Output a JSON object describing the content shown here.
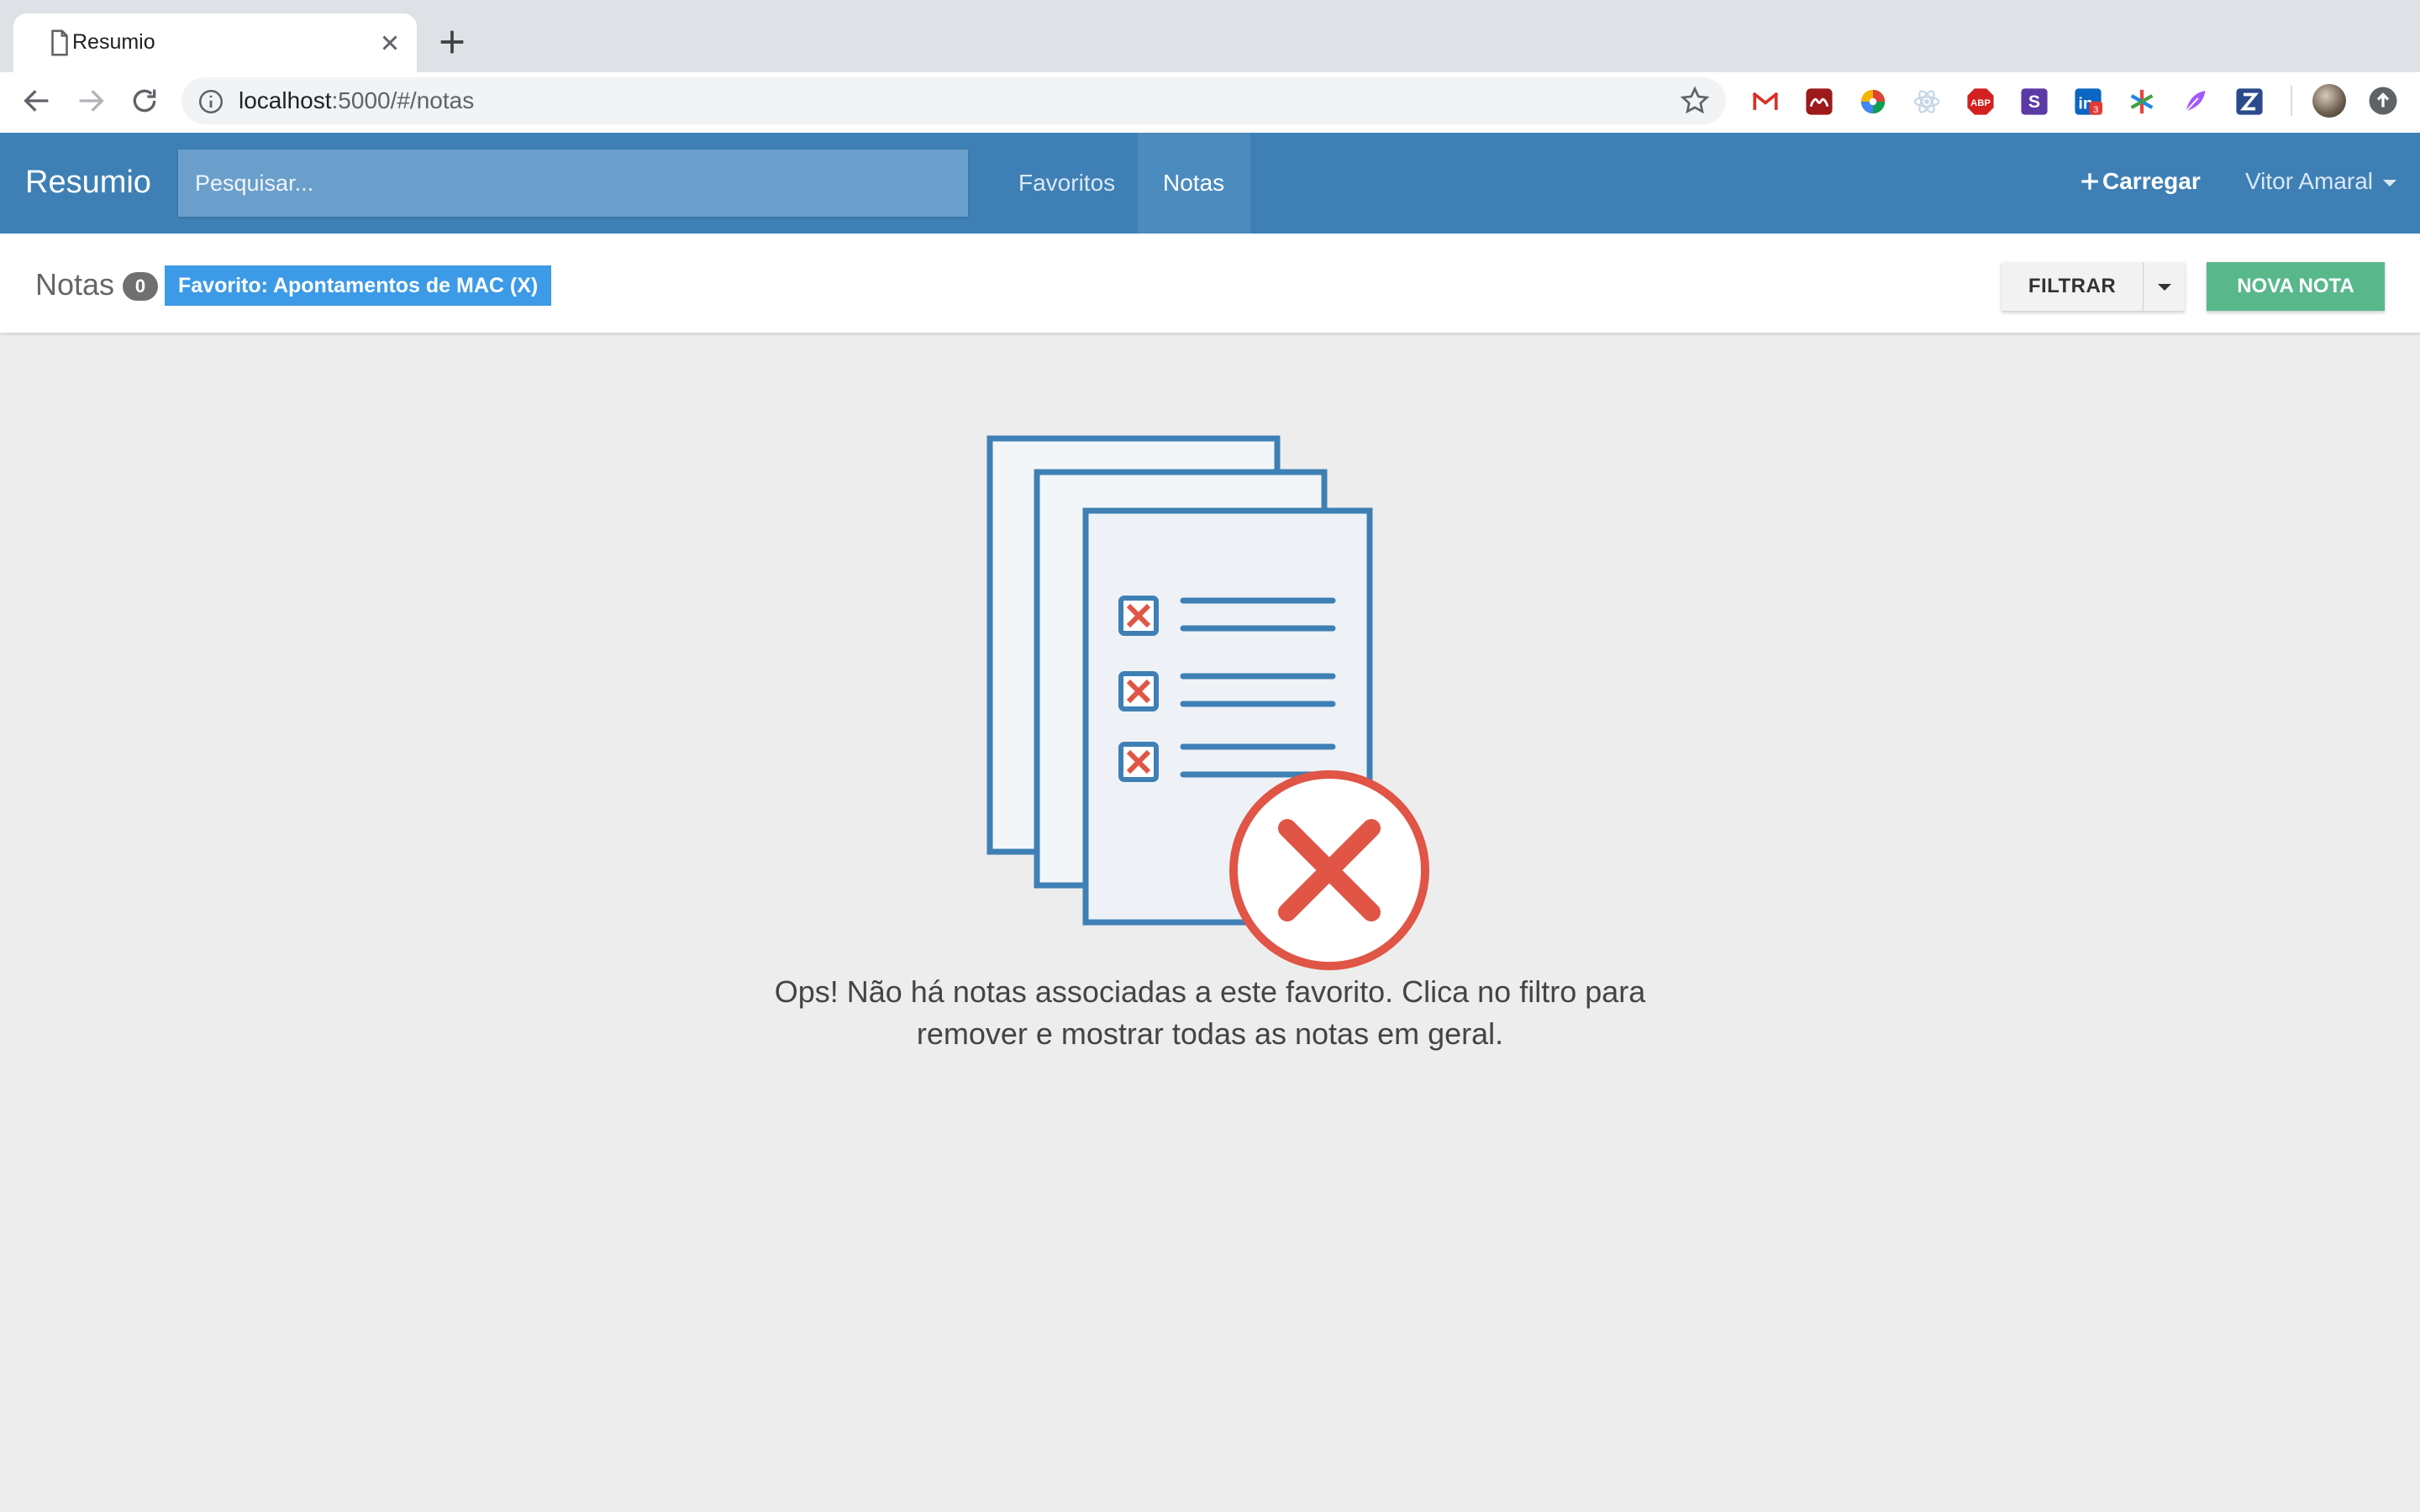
{
  "browser": {
    "tab_title": "Resumio",
    "url_host": "localhost",
    "url_path": ":5000/#/notas",
    "extensions": [
      {
        "name": "gmail-icon",
        "color": "#d93025"
      },
      {
        "name": "mendeley-icon",
        "color": "#9d1a1a"
      },
      {
        "name": "color-wheel-icon",
        "color": "#f4b400"
      },
      {
        "name": "react-devtools-icon",
        "color": "#c5d5e5"
      },
      {
        "name": "adblock-plus-icon",
        "color": "#d32121"
      },
      {
        "name": "s-extension-icon",
        "color": "#5b3aa6"
      },
      {
        "name": "linkedin-icon",
        "color": "#0a66c2"
      },
      {
        "name": "asterisk-extension-icon",
        "color": "#e8453c"
      },
      {
        "name": "feather-extension-icon",
        "color": "#a259ff"
      },
      {
        "name": "z-extension-icon",
        "color": "#2a4a8b"
      }
    ],
    "linkedin_badge": "3"
  },
  "app": {
    "brand": "Resumio",
    "search_placeholder": "Pesquisar...",
    "nav": {
      "favorites": "Favoritos",
      "notes": "Notas"
    },
    "upload": "Carregar",
    "user": "Vitor Amaral"
  },
  "subheader": {
    "title": "Notas",
    "count": "0",
    "favorite_tag": "Favorito: Apontamentos de MAC (X)",
    "filter": "FILTRAR",
    "new_note": "NOVA NOTA"
  },
  "empty_state": {
    "message": "Ops! Não há notas associadas a este favorito. Clica no filtro para remover e mostrar todas as notas em geral."
  },
  "colors": {
    "navbar": "#3e80b5",
    "accent_tag": "#3c9ae6",
    "new_note": "#58b88c",
    "error_red": "#e05545",
    "doc_blue": "#3e80b5"
  }
}
